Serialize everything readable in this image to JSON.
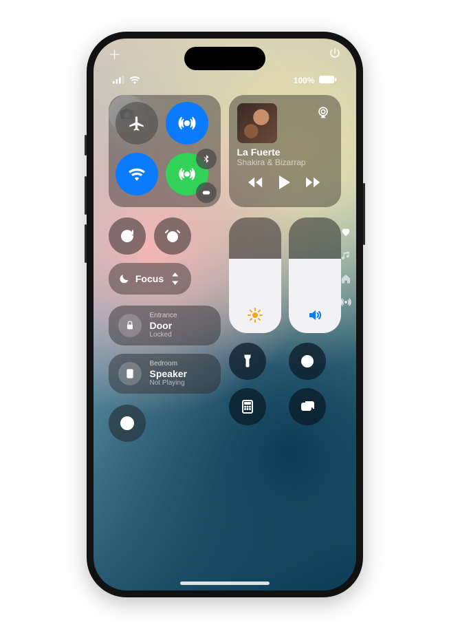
{
  "topbar": {
    "add_icon": "plus",
    "power_icon": "power"
  },
  "status": {
    "signal_bars": 3,
    "wifi_bars": 3,
    "battery_label": "100%"
  },
  "connectivity": {
    "airplane": {
      "on": false
    },
    "airdrop": {
      "on": true
    },
    "wifi": {
      "on": true
    },
    "cellular": {
      "on": true
    },
    "bluetooth": {
      "on": true
    },
    "hotspot": {
      "visible": true
    }
  },
  "media": {
    "title": "La Fuerte",
    "artist": "Shakira & Bizarrap",
    "airplay_icon": "airplay",
    "controls": {
      "prev": "rewind",
      "play": "play",
      "next": "forward"
    }
  },
  "controls": {
    "orientation_lock": {
      "icon": "rotation-lock"
    },
    "alarm": {
      "icon": "alarm"
    },
    "focus": {
      "label": "Focus",
      "icon": "moon"
    },
    "brightness": {
      "level": 0.56,
      "icon": "sun"
    },
    "volume": {
      "level": 0.56,
      "icon": "speaker"
    },
    "flashlight": {
      "icon": "flashlight"
    },
    "timer": {
      "icon": "timer"
    },
    "calculator": {
      "icon": "calculator"
    },
    "screen_mirroring": {
      "icon": "rectangles"
    },
    "screen_record": {
      "icon": "record"
    },
    "camera": {
      "icon": "camera"
    }
  },
  "home": {
    "entrance": {
      "room": "Entrance",
      "name": "Door",
      "status": "Locked",
      "icon": "lock"
    },
    "speaker": {
      "room": "Bedroom",
      "name": "Speaker",
      "status": "Not Playing",
      "icon": "speaker-box"
    }
  },
  "side_nav": {
    "items": [
      "heart",
      "music",
      "home",
      "broadcast"
    ],
    "active": 0
  }
}
